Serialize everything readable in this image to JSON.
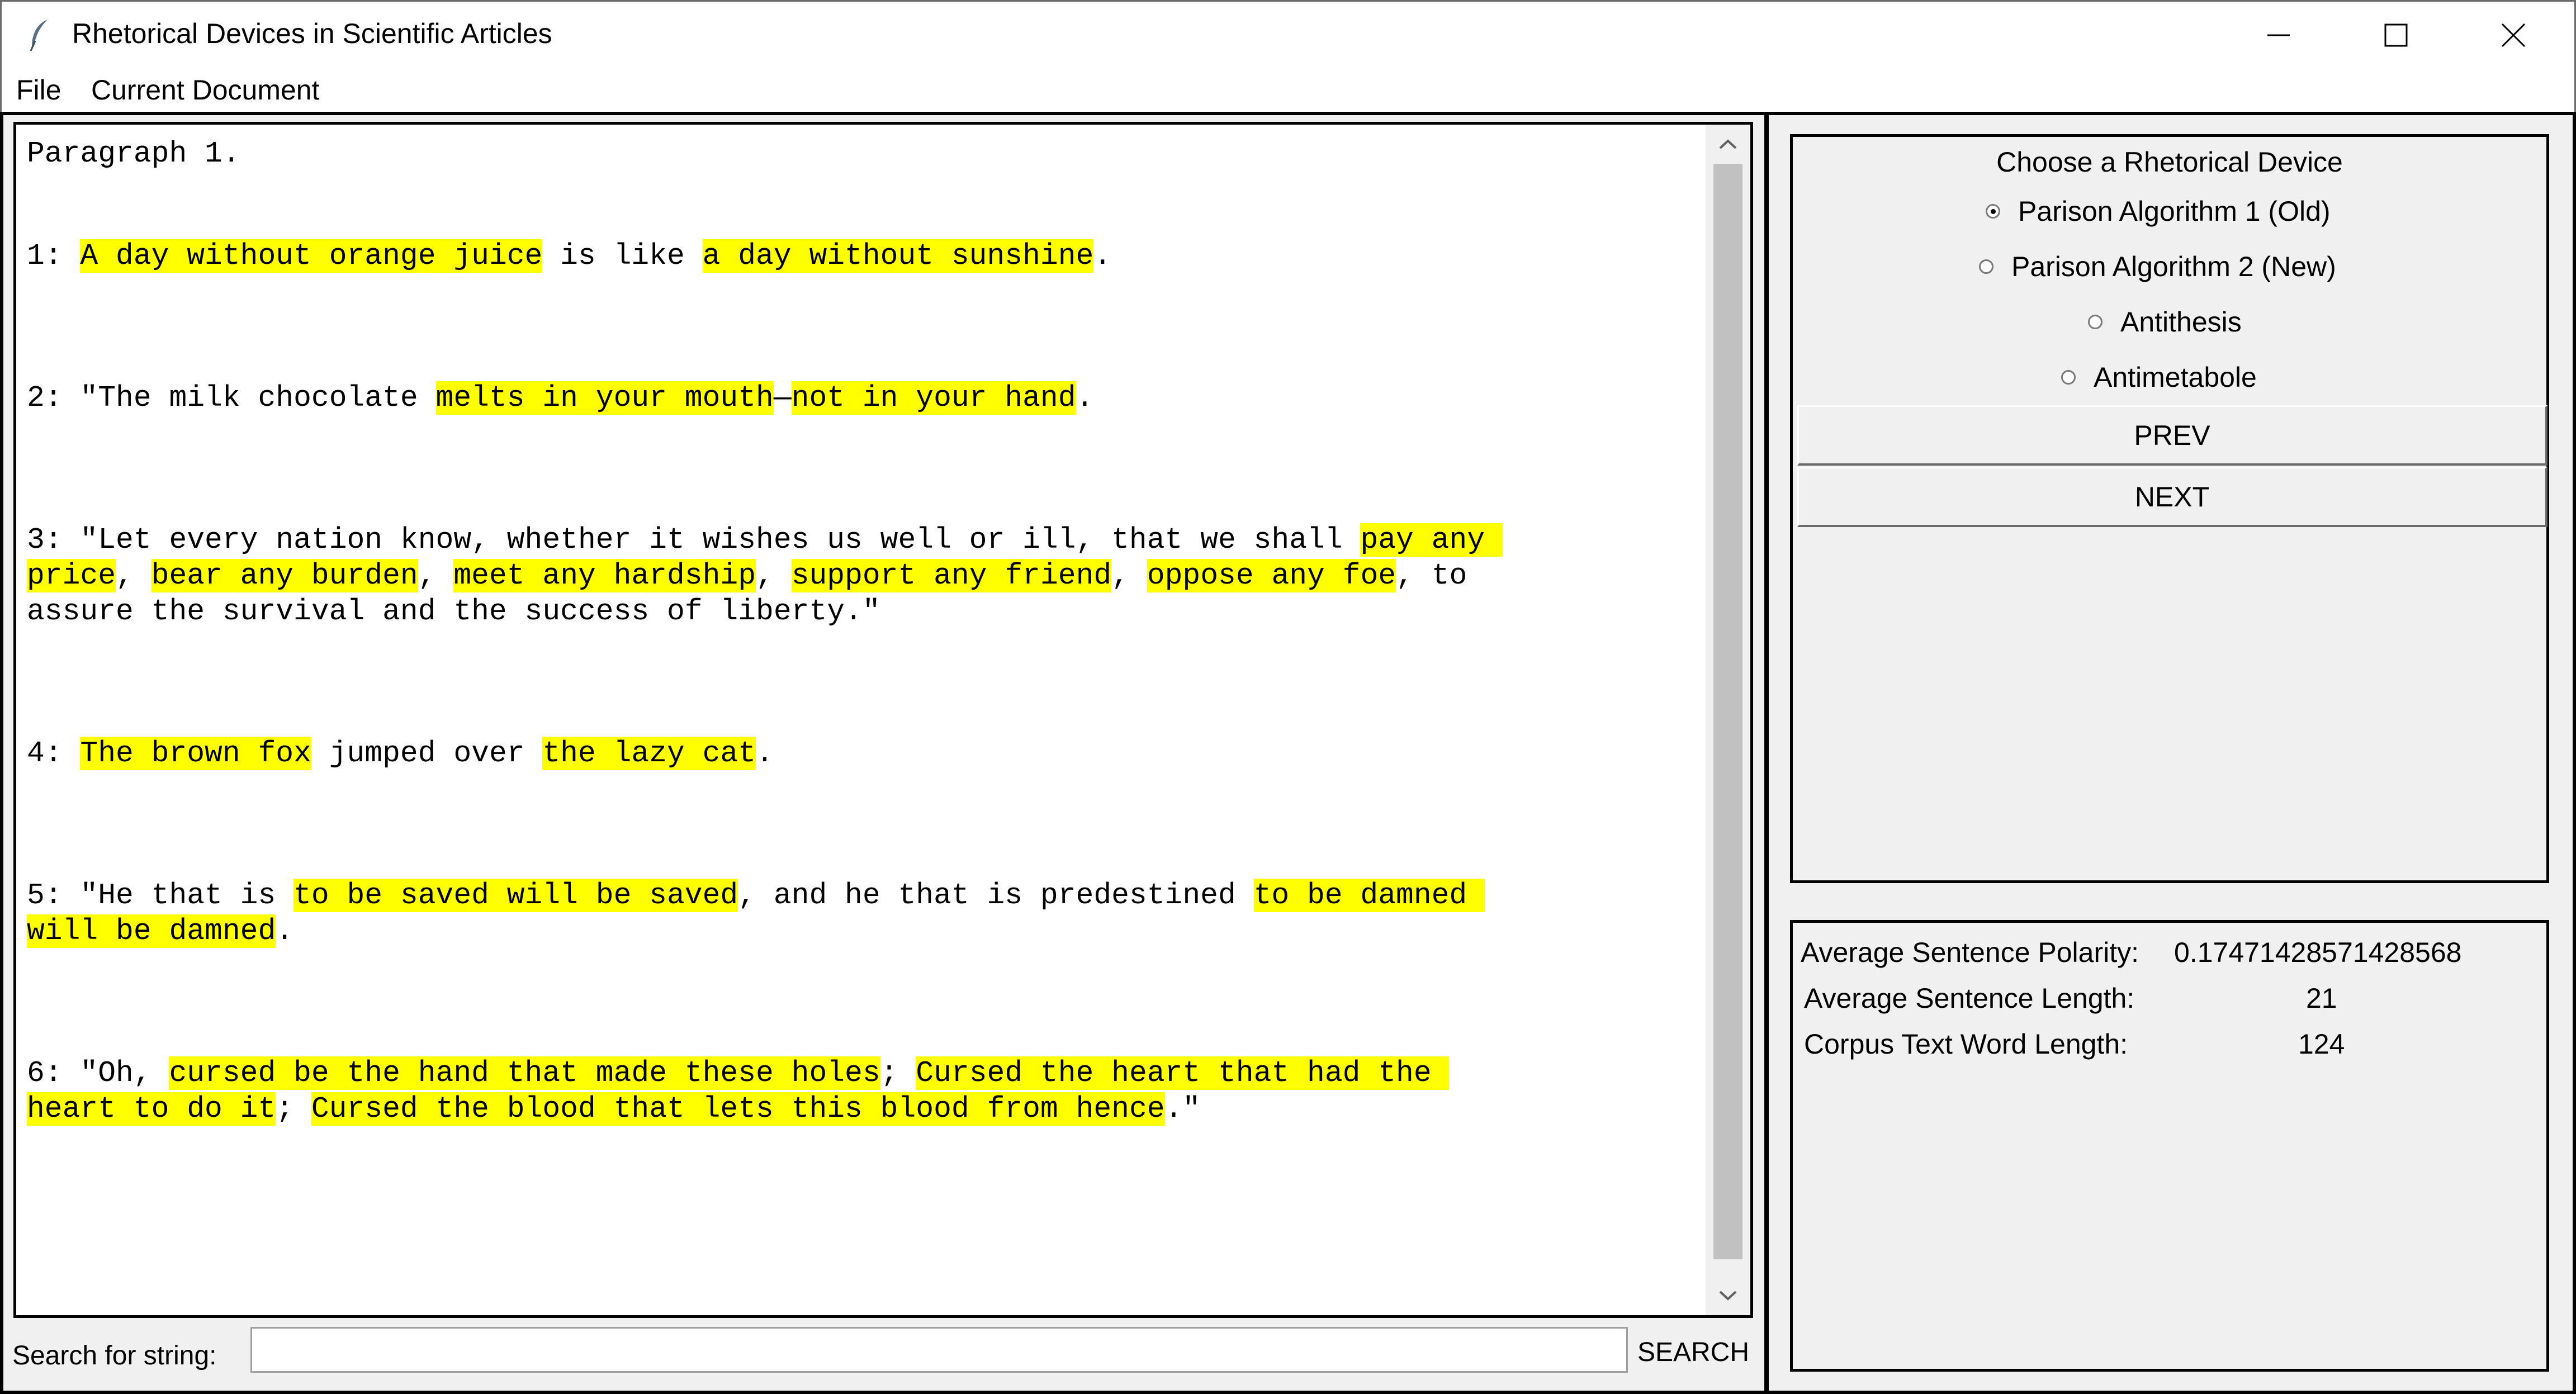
{
  "window": {
    "title": "Rhetorical Devices in Scientific Articles",
    "icon": "feather-icon"
  },
  "menu": [
    "File",
    "Current Document"
  ],
  "editor": {
    "heading": "Paragraph 1.",
    "lines": [
      [
        {
          "t": "1: "
        },
        {
          "t": "A day without orange juice",
          "h": 1
        },
        {
          "t": " is like "
        },
        {
          "t": "a day without sunshine",
          "h": 1
        },
        {
          "t": "."
        }
      ],
      [
        {
          "t": "2: \"The milk chocolate "
        },
        {
          "t": "melts in your mouth",
          "h": 1
        },
        {
          "t": "—"
        },
        {
          "t": "not in your hand",
          "h": 1
        },
        {
          "t": "."
        }
      ],
      [
        {
          "t": "3: \"Let every nation know, whether it wishes us well or ill, that we shall "
        },
        {
          "t": "pay any ",
          "h": 1
        }
      ],
      [
        {
          "t": "price",
          "h": 1
        },
        {
          "t": ", "
        },
        {
          "t": "bear any burden",
          "h": 1
        },
        {
          "t": ", "
        },
        {
          "t": "meet any hardship",
          "h": 1
        },
        {
          "t": ", "
        },
        {
          "t": "support any friend",
          "h": 1
        },
        {
          "t": ", "
        },
        {
          "t": "oppose any foe",
          "h": 1
        },
        {
          "t": ", to"
        }
      ],
      [
        {
          "t": "assure the survival and the success of liberty.\""
        }
      ],
      [
        {
          "t": "4: "
        },
        {
          "t": "The brown fox",
          "h": 1
        },
        {
          "t": " jumped over "
        },
        {
          "t": "the lazy cat",
          "h": 1
        },
        {
          "t": "."
        }
      ],
      [
        {
          "t": "5: \"He that is "
        },
        {
          "t": "to be saved will be saved",
          "h": 1
        },
        {
          "t": ", and he that is predestined "
        },
        {
          "t": "to be damned ",
          "h": 1
        }
      ],
      [
        {
          "t": "will be damned",
          "h": 1
        },
        {
          "t": "."
        }
      ],
      [
        {
          "t": "6: \"Oh, "
        },
        {
          "t": "cursed be the hand that made these holes",
          "h": 1
        },
        {
          "t": "; "
        },
        {
          "t": "Cursed the heart that had the ",
          "h": 1
        }
      ],
      [
        {
          "t": "heart to do it",
          "h": 1
        },
        {
          "t": "; "
        },
        {
          "t": "Cursed the blood that lets this blood from hence",
          "h": 1
        },
        {
          "t": ".\""
        }
      ]
    ]
  },
  "search": {
    "label": "Search for string:",
    "value": "",
    "button": "SEARCH"
  },
  "devices": {
    "title": "Choose a Rhetorical Device",
    "options": [
      {
        "label": "Parison Algorithm 1 (Old)",
        "selected": true
      },
      {
        "label": "Parison Algorithm 2 (New)",
        "selected": false
      },
      {
        "label": "Antithesis",
        "selected": false
      },
      {
        "label": "Antimetabole",
        "selected": false
      }
    ],
    "prev": "PREV",
    "next": "NEXT"
  },
  "stats": [
    {
      "label": "Average Sentence Polarity:",
      "value": "0.17471428571428568"
    },
    {
      "label": "Average Sentence Length:",
      "value": "21"
    },
    {
      "label": "Corpus Text Word Length:",
      "value": "124"
    }
  ],
  "colors": {
    "highlight": "#ffff00",
    "text": "#000000",
    "window_bg": "#f0f0f0",
    "scroll_thumb": "#c1c1c1"
  }
}
